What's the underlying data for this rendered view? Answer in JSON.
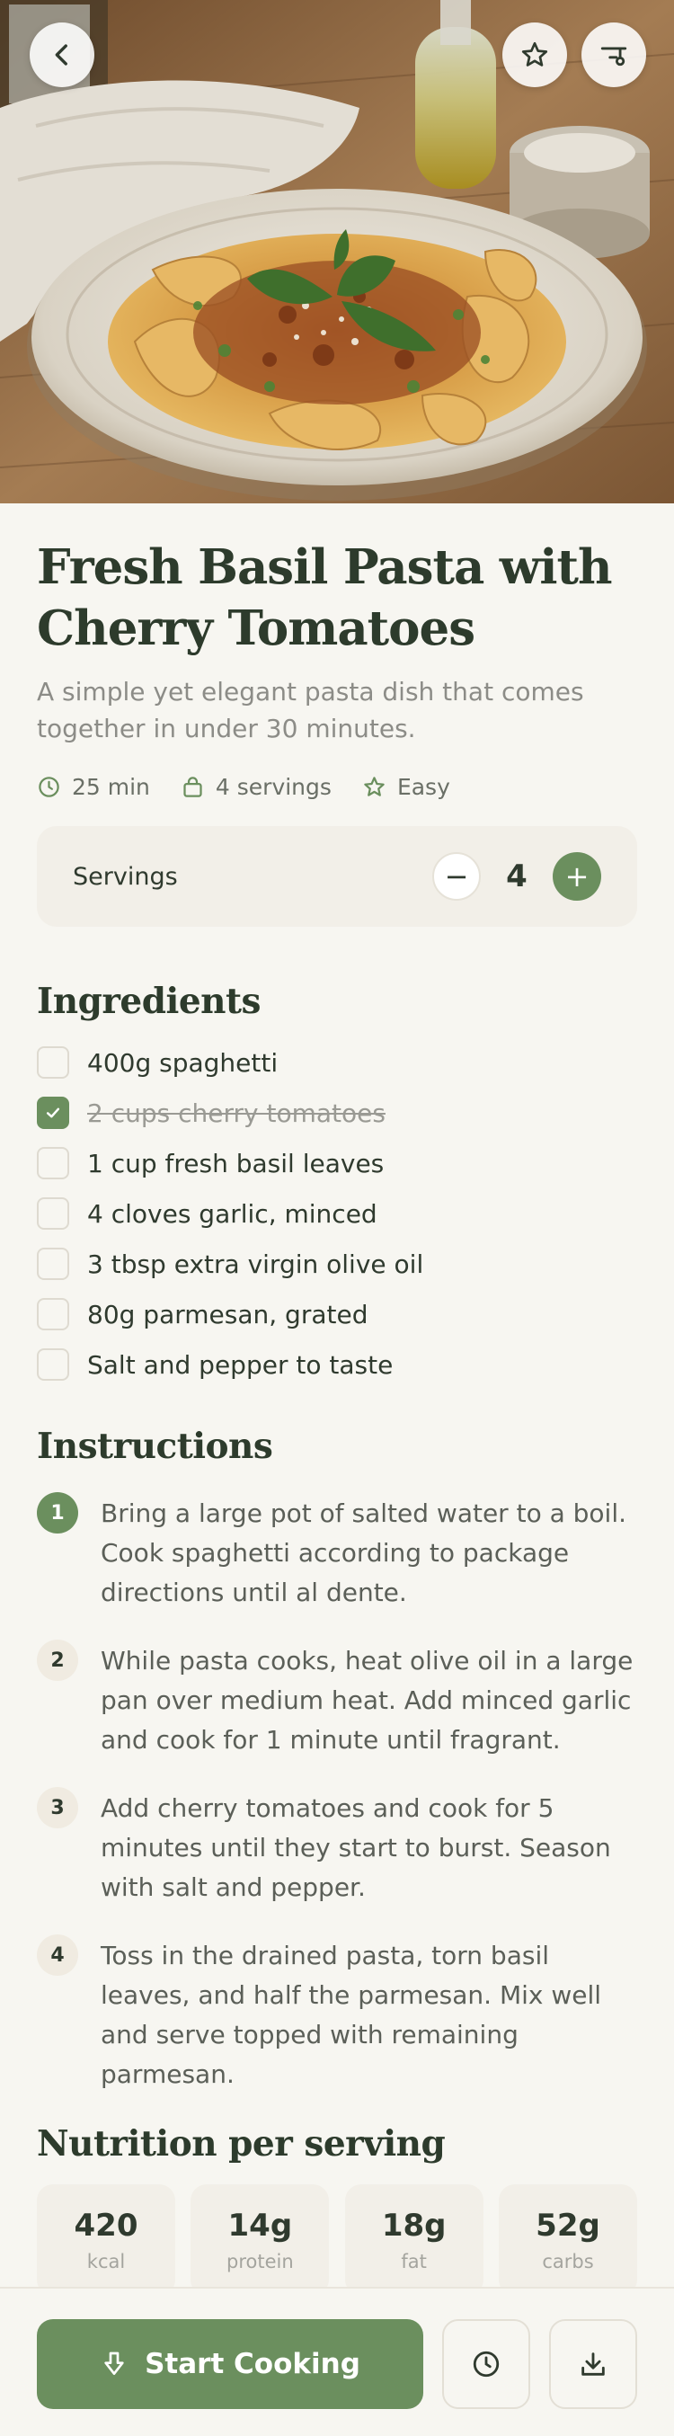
{
  "hero": {
    "image_alt": "pasta-dish-photo",
    "back_icon": "chevron-left-icon",
    "favorite_icon": "star-icon",
    "filter_icon": "filter-icon"
  },
  "recipe": {
    "title": "Fresh Basil Pasta with Cherry Tomatoes",
    "subtitle": "A simple yet elegant pasta dish that comes together in under 30 minutes.",
    "meta": {
      "time": "25 min",
      "servings": "4 servings",
      "difficulty": "Easy"
    }
  },
  "servings_card": {
    "label": "Servings",
    "minus": "−",
    "value": "4",
    "plus": "+"
  },
  "ingredients": {
    "heading": "Ingredients",
    "items": [
      {
        "text": "400g spaghetti",
        "checked": false
      },
      {
        "text": "2 cups cherry tomatoes",
        "checked": true
      },
      {
        "text": "1 cup fresh basil leaves",
        "checked": false
      },
      {
        "text": "4 cloves garlic, minced",
        "checked": false
      },
      {
        "text": "3 tbsp extra virgin olive oil",
        "checked": false
      },
      {
        "text": "80g parmesan, grated",
        "checked": false
      },
      {
        "text": "Salt and pepper to taste",
        "checked": false
      }
    ]
  },
  "instructions": {
    "heading": "Instructions",
    "steps": [
      {
        "num": "1",
        "text": "Bring a large pot of salted water to a boil. Cook spaghetti according to package directions until al dente."
      },
      {
        "num": "2",
        "text": "While pasta cooks, heat olive oil in a large pan over medium heat. Add minced garlic and cook for 1 minute until fragrant."
      },
      {
        "num": "3",
        "text": "Add cherry tomatoes and cook for 5 minutes until they start to burst. Season with salt and pepper."
      },
      {
        "num": "4",
        "text": "Toss in the drained pasta, torn basil leaves, and half the parmesan. Mix well and serve topped with remaining parmesan."
      }
    ]
  },
  "nutrition": {
    "heading": "Nutrition per serving",
    "items": [
      {
        "value": "420",
        "label": "kcal"
      },
      {
        "value": "14g",
        "label": "protein"
      },
      {
        "value": "18g",
        "label": "fat"
      },
      {
        "value": "52g",
        "label": "carbs"
      }
    ]
  },
  "bottom_bar": {
    "start_label": "Start Cooking"
  },
  "colors": {
    "accent": "#6b8f5e",
    "background": "#f7f6f1",
    "card": "#f2efe8",
    "heading": "#2d3b2c"
  }
}
